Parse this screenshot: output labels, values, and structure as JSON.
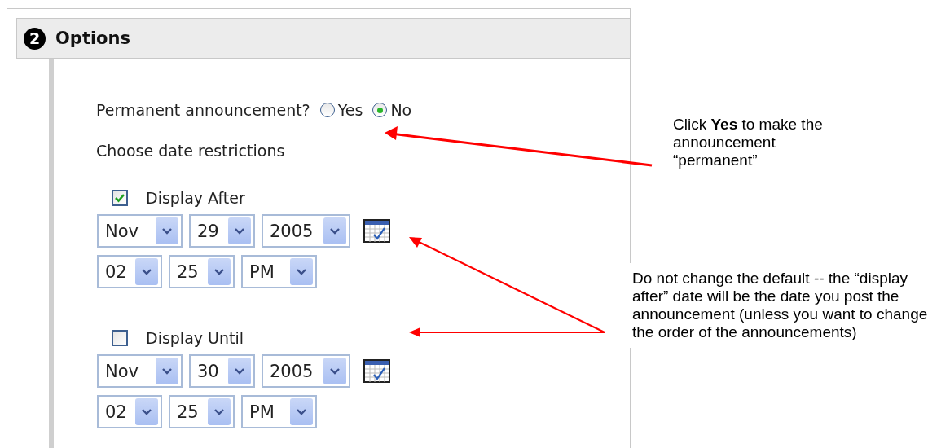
{
  "section": {
    "number": "2",
    "title": "Options"
  },
  "permanent": {
    "label": "Permanent announcement?",
    "options": [
      {
        "label": "Yes",
        "selected": false
      },
      {
        "label": "No",
        "selected": true
      }
    ]
  },
  "date_restrictions_label": "Choose date restrictions",
  "restrictions": [
    {
      "label": "Display After",
      "checked": true,
      "date": [
        "Nov",
        "29",
        "2005"
      ],
      "time": [
        "02",
        "25",
        "PM"
      ]
    },
    {
      "label": "Display Until",
      "checked": false,
      "date": [
        "Nov",
        "30",
        "2005"
      ],
      "time": [
        "02",
        "25",
        "PM"
      ]
    }
  ],
  "callouts": [
    {
      "text": "Click **Yes** to make the announcement “permanent”"
    },
    {
      "text": "Do not change the default -- the “display after” date will be the date you post the announcement (unless you want to change the order of the announcements)"
    }
  ]
}
